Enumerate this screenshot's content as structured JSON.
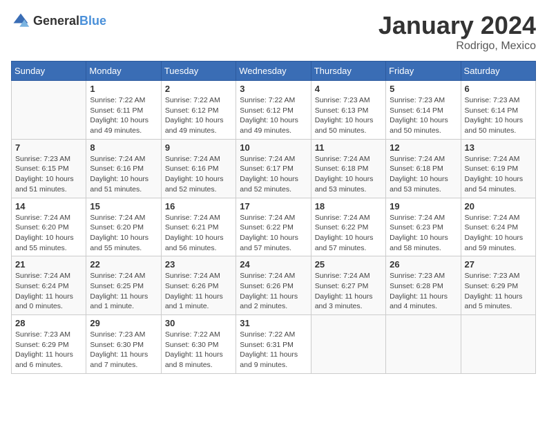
{
  "logo": {
    "text_general": "General",
    "text_blue": "Blue"
  },
  "title": {
    "month_year": "January 2024",
    "location": "Rodrigo, Mexico"
  },
  "days_of_week": [
    "Sunday",
    "Monday",
    "Tuesday",
    "Wednesday",
    "Thursday",
    "Friday",
    "Saturday"
  ],
  "weeks": [
    [
      {
        "day": "",
        "info": ""
      },
      {
        "day": "1",
        "info": "Sunrise: 7:22 AM\nSunset: 6:11 PM\nDaylight: 10 hours\nand 49 minutes."
      },
      {
        "day": "2",
        "info": "Sunrise: 7:22 AM\nSunset: 6:12 PM\nDaylight: 10 hours\nand 49 minutes."
      },
      {
        "day": "3",
        "info": "Sunrise: 7:22 AM\nSunset: 6:12 PM\nDaylight: 10 hours\nand 49 minutes."
      },
      {
        "day": "4",
        "info": "Sunrise: 7:23 AM\nSunset: 6:13 PM\nDaylight: 10 hours\nand 50 minutes."
      },
      {
        "day": "5",
        "info": "Sunrise: 7:23 AM\nSunset: 6:14 PM\nDaylight: 10 hours\nand 50 minutes."
      },
      {
        "day": "6",
        "info": "Sunrise: 7:23 AM\nSunset: 6:14 PM\nDaylight: 10 hours\nand 50 minutes."
      }
    ],
    [
      {
        "day": "7",
        "info": "Sunrise: 7:23 AM\nSunset: 6:15 PM\nDaylight: 10 hours\nand 51 minutes."
      },
      {
        "day": "8",
        "info": "Sunrise: 7:24 AM\nSunset: 6:16 PM\nDaylight: 10 hours\nand 51 minutes."
      },
      {
        "day": "9",
        "info": "Sunrise: 7:24 AM\nSunset: 6:16 PM\nDaylight: 10 hours\nand 52 minutes."
      },
      {
        "day": "10",
        "info": "Sunrise: 7:24 AM\nSunset: 6:17 PM\nDaylight: 10 hours\nand 52 minutes."
      },
      {
        "day": "11",
        "info": "Sunrise: 7:24 AM\nSunset: 6:18 PM\nDaylight: 10 hours\nand 53 minutes."
      },
      {
        "day": "12",
        "info": "Sunrise: 7:24 AM\nSunset: 6:18 PM\nDaylight: 10 hours\nand 53 minutes."
      },
      {
        "day": "13",
        "info": "Sunrise: 7:24 AM\nSunset: 6:19 PM\nDaylight: 10 hours\nand 54 minutes."
      }
    ],
    [
      {
        "day": "14",
        "info": "Sunrise: 7:24 AM\nSunset: 6:20 PM\nDaylight: 10 hours\nand 55 minutes."
      },
      {
        "day": "15",
        "info": "Sunrise: 7:24 AM\nSunset: 6:20 PM\nDaylight: 10 hours\nand 55 minutes."
      },
      {
        "day": "16",
        "info": "Sunrise: 7:24 AM\nSunset: 6:21 PM\nDaylight: 10 hours\nand 56 minutes."
      },
      {
        "day": "17",
        "info": "Sunrise: 7:24 AM\nSunset: 6:22 PM\nDaylight: 10 hours\nand 57 minutes."
      },
      {
        "day": "18",
        "info": "Sunrise: 7:24 AM\nSunset: 6:22 PM\nDaylight: 10 hours\nand 57 minutes."
      },
      {
        "day": "19",
        "info": "Sunrise: 7:24 AM\nSunset: 6:23 PM\nDaylight: 10 hours\nand 58 minutes."
      },
      {
        "day": "20",
        "info": "Sunrise: 7:24 AM\nSunset: 6:24 PM\nDaylight: 10 hours\nand 59 minutes."
      }
    ],
    [
      {
        "day": "21",
        "info": "Sunrise: 7:24 AM\nSunset: 6:24 PM\nDaylight: 11 hours\nand 0 minutes."
      },
      {
        "day": "22",
        "info": "Sunrise: 7:24 AM\nSunset: 6:25 PM\nDaylight: 11 hours\nand 1 minute."
      },
      {
        "day": "23",
        "info": "Sunrise: 7:24 AM\nSunset: 6:26 PM\nDaylight: 11 hours\nand 1 minute."
      },
      {
        "day": "24",
        "info": "Sunrise: 7:24 AM\nSunset: 6:26 PM\nDaylight: 11 hours\nand 2 minutes."
      },
      {
        "day": "25",
        "info": "Sunrise: 7:24 AM\nSunset: 6:27 PM\nDaylight: 11 hours\nand 3 minutes."
      },
      {
        "day": "26",
        "info": "Sunrise: 7:23 AM\nSunset: 6:28 PM\nDaylight: 11 hours\nand 4 minutes."
      },
      {
        "day": "27",
        "info": "Sunrise: 7:23 AM\nSunset: 6:29 PM\nDaylight: 11 hours\nand 5 minutes."
      }
    ],
    [
      {
        "day": "28",
        "info": "Sunrise: 7:23 AM\nSunset: 6:29 PM\nDaylight: 11 hours\nand 6 minutes."
      },
      {
        "day": "29",
        "info": "Sunrise: 7:23 AM\nSunset: 6:30 PM\nDaylight: 11 hours\nand 7 minutes."
      },
      {
        "day": "30",
        "info": "Sunrise: 7:22 AM\nSunset: 6:30 PM\nDaylight: 11 hours\nand 8 minutes."
      },
      {
        "day": "31",
        "info": "Sunrise: 7:22 AM\nSunset: 6:31 PM\nDaylight: 11 hours\nand 9 minutes."
      },
      {
        "day": "",
        "info": ""
      },
      {
        "day": "",
        "info": ""
      },
      {
        "day": "",
        "info": ""
      }
    ]
  ]
}
